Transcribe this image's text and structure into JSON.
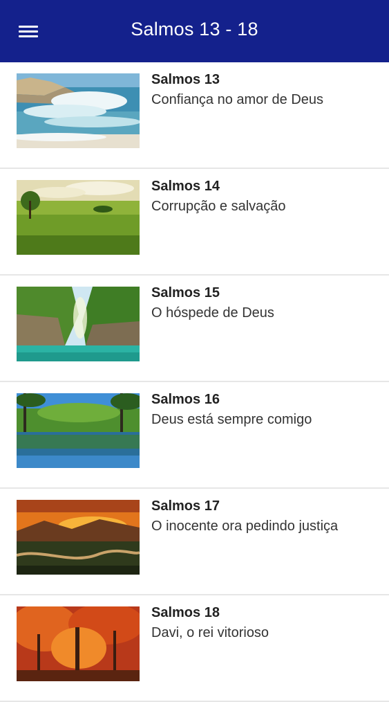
{
  "appbar": {
    "title": "Salmos 13 - 18",
    "background": "#14218c",
    "menu_icon": "hamburger-menu-icon"
  },
  "items": [
    {
      "title": "Salmos 13",
      "subtitle": "Confiança no amor de Deus",
      "image": "ocean-waves-image"
    },
    {
      "title": "Salmos 14",
      "subtitle": "Corrupção e salvação",
      "image": "green-meadow-image"
    },
    {
      "title": "Salmos 15",
      "subtitle": "O hóspede de Deus",
      "image": "tropical-cliffs-image"
    },
    {
      "title": "Salmos 16",
      "subtitle": "Deus está sempre comigo",
      "image": "forest-lake-reflection-image"
    },
    {
      "title": "Salmos 17",
      "subtitle": "O inocente ora pedindo justiça",
      "image": "sunset-valley-image"
    },
    {
      "title": "Salmos 18",
      "subtitle": "Davi, o rei vitorioso",
      "image": "autumn-forest-image"
    }
  ]
}
